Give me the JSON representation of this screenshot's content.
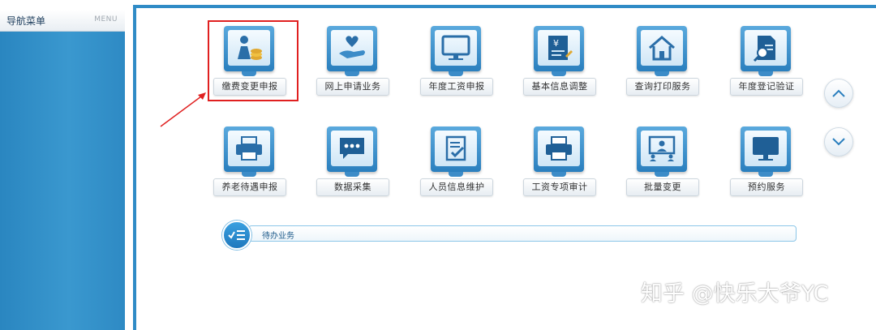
{
  "sidebar": {
    "title": "导航菜单",
    "menu_label": "MENU"
  },
  "tiles_row1": [
    {
      "label": "缴费变更申报",
      "icon": "person-coins-icon"
    },
    {
      "label": "网上申请业务",
      "icon": "heart-hand-icon"
    },
    {
      "label": "年度工资申报",
      "icon": "monitor-icon"
    },
    {
      "label": "基本信息调整",
      "icon": "yen-document-icon"
    },
    {
      "label": "查询打印服务",
      "icon": "house-icon"
    },
    {
      "label": "年度登记验证",
      "icon": "document-search-icon"
    }
  ],
  "tiles_row2": [
    {
      "label": "养老待遇申报",
      "icon": "printer-icon"
    },
    {
      "label": "数据采集",
      "icon": "chat-bubble-icon"
    },
    {
      "label": "人员信息维护",
      "icon": "clipboard-check-icon"
    },
    {
      "label": "工资专项审计",
      "icon": "printer-icon"
    },
    {
      "label": "批量变更",
      "icon": "presentation-icon"
    },
    {
      "label": "预约服务",
      "icon": "monitor-icon"
    }
  ],
  "pending": {
    "label": "待办业务",
    "icon": "checklist-icon"
  },
  "scroll": {
    "up_icon": "chevron-up-icon",
    "down_icon": "chevron-down-icon"
  },
  "watermark": "知乎 @快乐大爷YC",
  "colors": {
    "frame_blue": "#2f8bc6",
    "highlight_red": "#e02020",
    "icon_blue": "#2a7fbe"
  }
}
